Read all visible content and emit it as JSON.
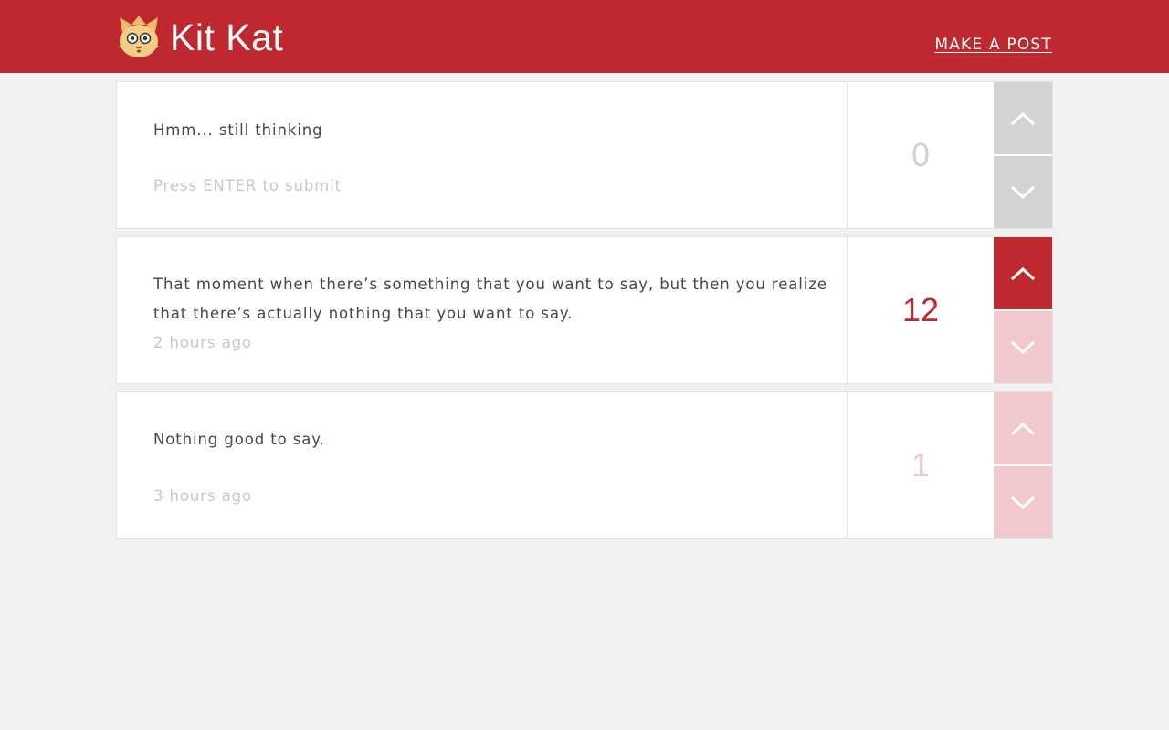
{
  "app": {
    "title": "Kit Kat",
    "make_post_label": "MAKE A POST"
  },
  "colors": {
    "brand": "#c0282f",
    "score_neutral": "#d1d1d1",
    "score_active": "#c0282f",
    "score_faded": "#f1c8cd"
  },
  "composer": {
    "value": "Hmm... still thinking",
    "hint": "Press ENTER to submit",
    "score": "0"
  },
  "posts": [
    {
      "text": "That moment when there’s something that you want to say, but then you realize that there’s actually nothing that you want to say.",
      "time": "2 hours ago",
      "score": "12"
    },
    {
      "text": "Nothing good to say.",
      "time": "3 hours ago",
      "score": "1"
    }
  ]
}
